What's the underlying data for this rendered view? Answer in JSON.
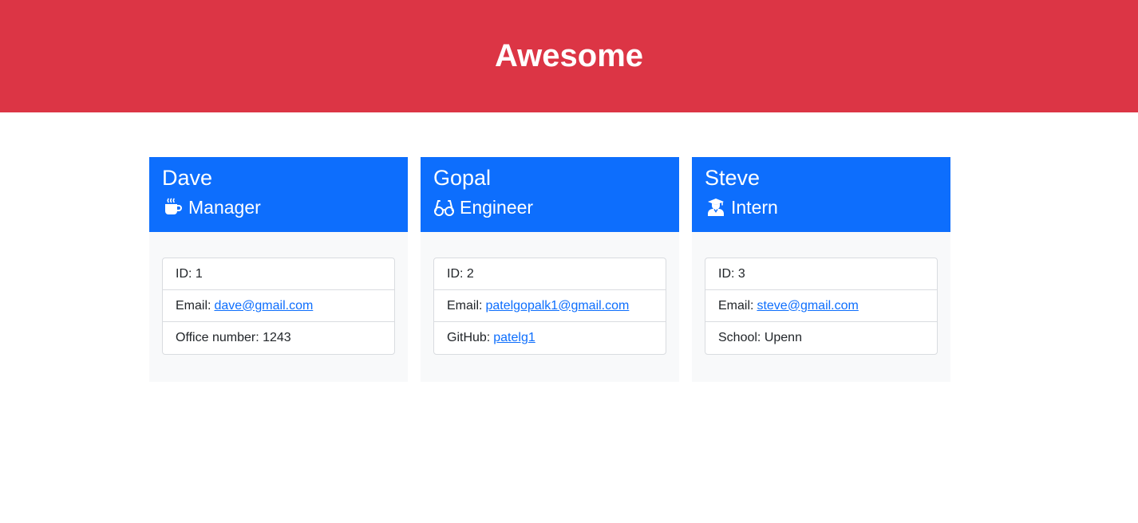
{
  "page": {
    "title": "Awesome",
    "banner_color": "#dc3545",
    "card_header_color": "#0d6efd"
  },
  "team": [
    {
      "name": "Dave",
      "role": "Manager",
      "role_icon": "mug-hot-icon",
      "id_label": "ID: 1",
      "email_label": "Email:",
      "email": "dave@gmail.com",
      "extra_label": "Office number: 1243",
      "extra_link": ""
    },
    {
      "name": "Gopal",
      "role": "Engineer",
      "role_icon": "glasses-icon",
      "id_label": "ID: 2",
      "email_label": "Email:",
      "email": "patelgopalk1@gmail.com",
      "extra_label": "GitHub:",
      "extra_link": "patelg1"
    },
    {
      "name": "Steve",
      "role": "Intern",
      "role_icon": "user-graduate-icon",
      "id_label": "ID: 3",
      "email_label": "Email:",
      "email": "steve@gmail.com",
      "extra_label": "School: Upenn",
      "extra_link": ""
    }
  ]
}
